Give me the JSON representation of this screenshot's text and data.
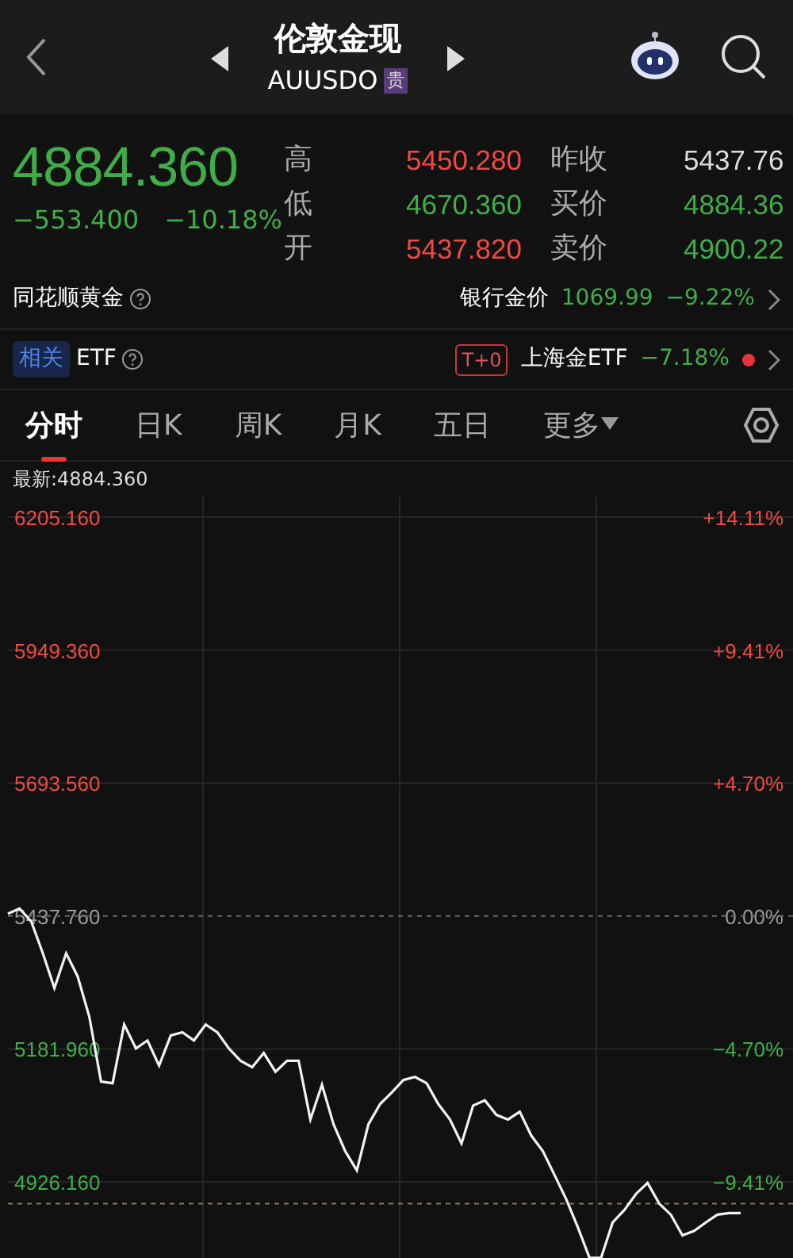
{
  "header": {
    "title": "伦敦金现",
    "symbol": "AUUSDO",
    "badge": "贵"
  },
  "quote": {
    "price": "4884.360",
    "color": "#3fae49",
    "change": "−553.400",
    "change_pct": "−10.18%",
    "stats": [
      {
        "label": "高",
        "value": "5450.280",
        "color": "#ee4a43"
      },
      {
        "label": "昨收",
        "value": "5437.76",
        "color": "#dddddd"
      },
      {
        "label": "低",
        "value": "4670.360",
        "color": "#3fae49"
      },
      {
        "label": "买价",
        "value": "4884.36",
        "color": "#3fae49"
      },
      {
        "label": "开",
        "value": "5437.820",
        "color": "#ee4a43"
      },
      {
        "label": "卖价",
        "value": "4900.22",
        "color": "#3fae49"
      }
    ]
  },
  "gold_row": {
    "title": "同花顺黄金",
    "right_label": "银行金价",
    "price": "1069.99",
    "change_pct": "−9.22%",
    "color": "#3fae49"
  },
  "etf_row": {
    "tag": "相关",
    "title": "ETF",
    "tplus": "T+0",
    "fund": "上海金ETF",
    "change_pct": "−7.18%",
    "color": "#3fae49",
    "status_dot": {
      "color": "#e8323a"
    }
  },
  "tabs": [
    {
      "label": "分时",
      "selected": true
    },
    {
      "label": "日K",
      "selected": false
    },
    {
      "label": "周K",
      "selected": false
    },
    {
      "label": "月K",
      "selected": false
    },
    {
      "label": "五日",
      "selected": false
    },
    {
      "label": "更多",
      "selected": false,
      "dropdown": true
    }
  ],
  "chart": {
    "latest": "最新:4884.360",
    "percent_labels": [
      "+14.11%",
      "+9.41%",
      "+4.70%",
      "0.00%",
      "−4.70%",
      "−9.41%"
    ],
    "chart_data": {
      "type": "line",
      "ylim": [
        4776.6,
        6244.8
      ],
      "grid": true,
      "ref_lines": [
        {
          "axis": "y",
          "value": 5437.76,
          "color": "#666666"
        },
        {
          "axis": "y",
          "value": 4884.36,
          "color": "#8a7a5c"
        }
      ],
      "yticks": [
        {
          "value": 6205.16,
          "label": "6205.160"
        },
        {
          "value": 5949.36,
          "label": "5949.360"
        },
        {
          "value": 5693.56,
          "label": "5693.560"
        },
        {
          "value": 5437.76,
          "label": "5437.760"
        },
        {
          "value": 5181.96,
          "label": "5181.960"
        },
        {
          "value": 4926.16,
          "label": "4926.160"
        }
      ],
      "categories": [
        null,
        null,
        null,
        null,
        null,
        null,
        null,
        null,
        null,
        null,
        null,
        null,
        null,
        null,
        null,
        null,
        null,
        null,
        null,
        null,
        null,
        null,
        null,
        null,
        null,
        null,
        null,
        null,
        null,
        null,
        null,
        null,
        null,
        null,
        null,
        null,
        null,
        null,
        null,
        null,
        null,
        null,
        null,
        null,
        null,
        null,
        null,
        null,
        null,
        null,
        null,
        null,
        null,
        null,
        null,
        null,
        null,
        null,
        null,
        null,
        null,
        null,
        null,
        null
      ],
      "series": [
        {
          "color": "#f2f2f2",
          "values": [
            5442,
            5452,
            5427,
            5366,
            5299,
            5366,
            5321,
            5244,
            5119,
            5116,
            5229,
            5183,
            5198,
            5150,
            5208,
            5214,
            5198,
            5229,
            5214,
            5183,
            5159,
            5147,
            5174,
            5138,
            5159,
            5159,
            5046,
            5113,
            5037,
            4985,
            4948,
            5037,
            5076,
            5098,
            5122,
            5128,
            5116,
            5076,
            5046,
            5000,
            5073,
            5083,
            5055,
            5046,
            5061,
            5015,
            4985,
            4939,
            4893,
            4839,
            4780,
            4780,
            4848,
            4872,
            4903,
            4924,
            4884,
            4863,
            4823,
            4832,
            4848,
            4863,
            4866,
            4866
          ]
        }
      ]
    }
  }
}
